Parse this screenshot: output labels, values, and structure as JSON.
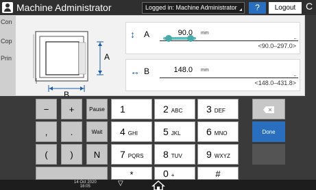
{
  "titlebar": {
    "title": "Machine Administrator",
    "login_status": "Logged in: Machine Administrator",
    "help": "?",
    "logout": "Logout",
    "extra": "C"
  },
  "background_menu": [
    "Con",
    "Cop",
    "Prin"
  ],
  "diagram": {
    "label_a": "A",
    "label_b": "B"
  },
  "row_a": {
    "icon": "↕",
    "label": "A",
    "value": "90.0",
    "unit": "mm",
    "range": "<90.0–297.0>",
    "dots": "..."
  },
  "row_b": {
    "icon": "↔",
    "label": "B",
    "value": "148.0",
    "unit": "mm",
    "range": "<148.0–431.8>",
    "dots": "..."
  },
  "keys": {
    "minus": "−",
    "plus": "+",
    "pause": "Pause",
    "comma": ",",
    "period": ".",
    "wait": "Wait",
    "lparen": "(",
    "rparen": ")",
    "n": "N",
    "k1": "1",
    "k2": "2",
    "k2s": "ABC",
    "k3": "3",
    "k3s": "DEF",
    "k4": "4",
    "k4s": "GHI",
    "k5": "5",
    "k5s": "JKL",
    "k6": "6",
    "k6s": "MNO",
    "k7": "7",
    "k7s": "PQRS",
    "k8": "8",
    "k8s": "TUV",
    "k9": "9",
    "k9s": "WXYZ",
    "star": "*",
    "k0": "0",
    "k0s": "+",
    "hash": "#",
    "done": "Done"
  },
  "statusbar": {
    "date": "14 Oct 2020",
    "time": "16:05"
  },
  "colors": {
    "accent": "#2a6fbf",
    "slider": "#5fbdbd",
    "titlebar": "#2f2f2f"
  }
}
